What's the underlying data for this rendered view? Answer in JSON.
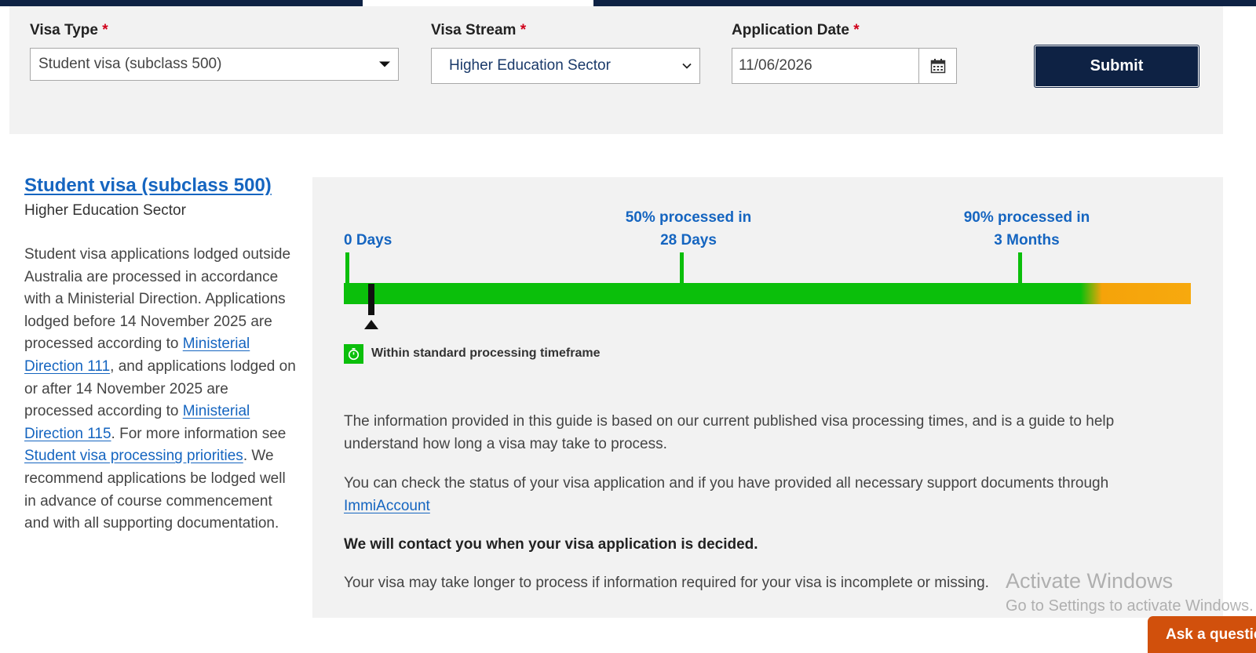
{
  "form": {
    "visa_type_label": "Visa Type",
    "visa_stream_label": "Visa Stream",
    "application_date_label": "Application Date",
    "required_marker": "*",
    "visa_type_value": "Student visa (subclass 500)",
    "visa_stream_value": "Higher Education Sector",
    "application_date_value": "11/06/2026",
    "submit_label": "Submit"
  },
  "result": {
    "title": "Student visa (subclass 500)",
    "subtitle": "Higher Education Sector",
    "desc_1": "Student visa applications lodged outside Australia are processed in accordance with a Ministerial Direction. Applications lodged before 14 November 2025 are processed according to ",
    "link_md111": "Ministerial Direction 111",
    "desc_2": ", and applications lodged on or after 14 November 2025 are processed according to ",
    "link_md115": "Ministerial Direction 115",
    "desc_3": ". For more information see ",
    "link_priorities": "Student visa processing priorities",
    "desc_4": ". We recommend applications be lodged well in advance of course commencement and with all supporting documentation."
  },
  "timeline": {
    "start_label": "0 Days",
    "mid_label_1": "50% processed in",
    "mid_label_2": "28 Days",
    "end_label_1": "90% processed in",
    "end_label_2": "3 Months",
    "status_text": "Within standard processing timeframe",
    "colors": {
      "within": "#0bbf0b",
      "beyond": "#f5a30a"
    }
  },
  "info": {
    "para_1": "The information provided in this guide is based on our current published visa processing times, and is a guide to help understand how long a visa may take to process.",
    "para_2": "You can check the status of your visa application and if you have provided all necessary support documents through ",
    "link_immi": "ImmiAccount",
    "para_3": "We will contact you when your visa application is decided.",
    "para_4": "Your visa may take longer to process if information required for your visa is incomplete or missing."
  },
  "overlay": {
    "watermark_1": "Activate Windows",
    "watermark_2": "Go to Settings to activate Windows.",
    "ask_button": "Ask a question"
  }
}
